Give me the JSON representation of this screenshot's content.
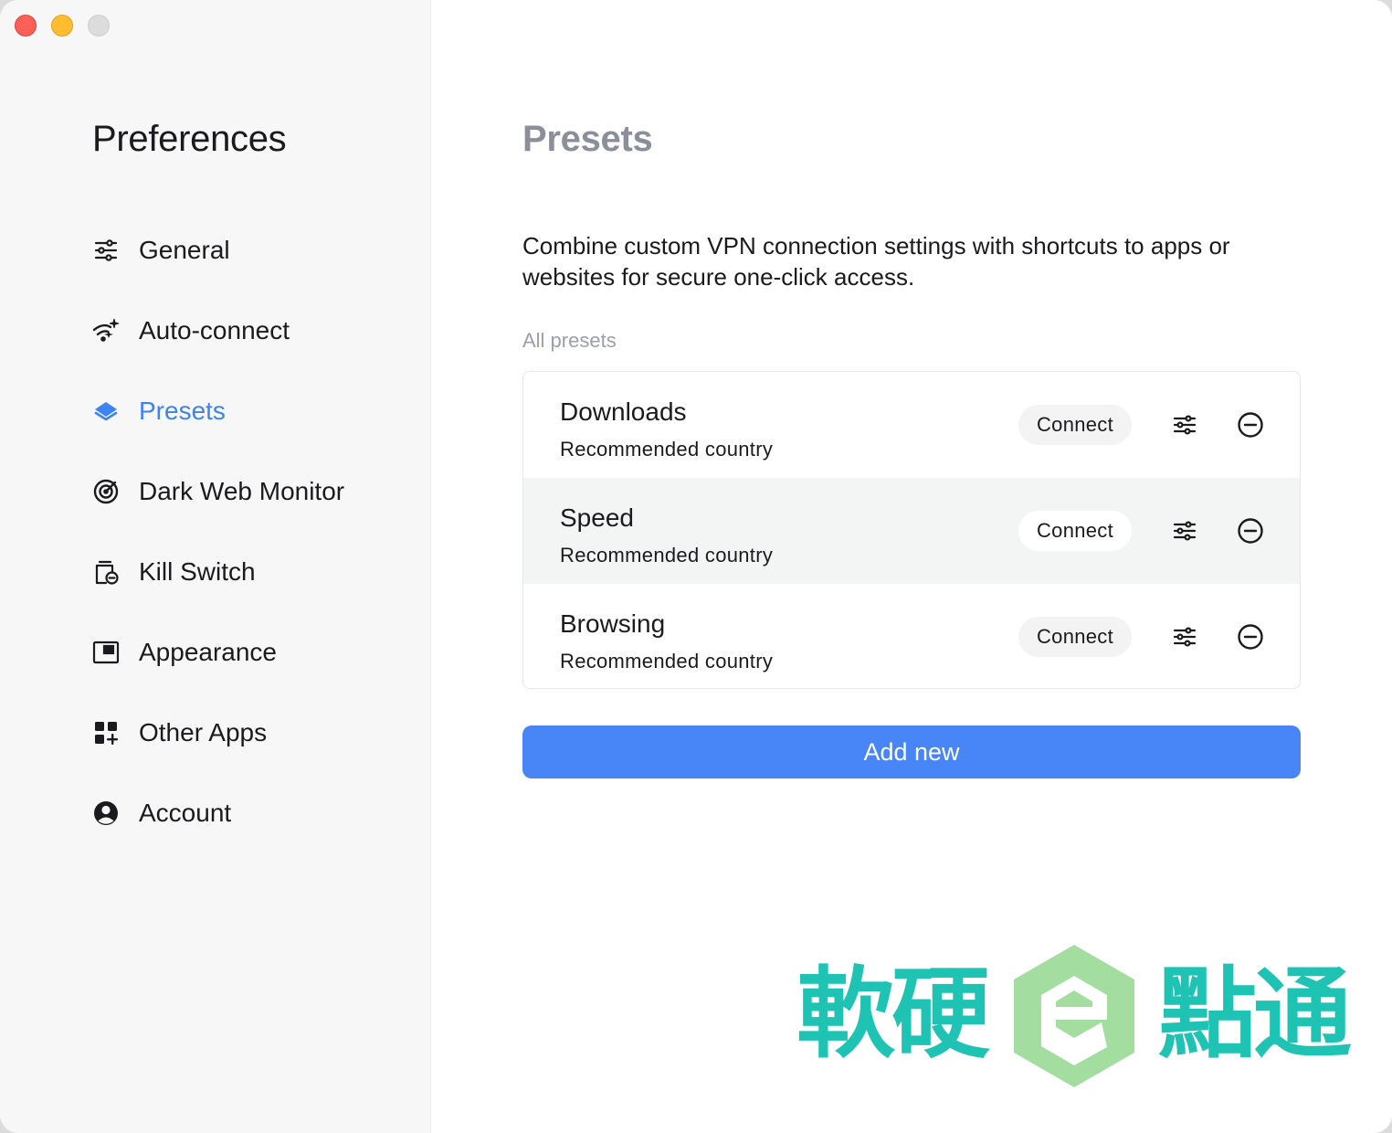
{
  "window": {
    "controls": [
      "close",
      "minimize",
      "zoom"
    ]
  },
  "sidebar": {
    "title": "Preferences",
    "items": [
      {
        "label": "General",
        "icon": "sliders-icon",
        "active": false
      },
      {
        "label": "Auto-connect",
        "icon": "wifi-sparkle-icon",
        "active": false
      },
      {
        "label": "Presets",
        "icon": "layers-icon",
        "active": true
      },
      {
        "label": "Dark Web Monitor",
        "icon": "target-icon",
        "active": false
      },
      {
        "label": "Kill Switch",
        "icon": "kill-switch-icon",
        "active": false
      },
      {
        "label": "Appearance",
        "icon": "appearance-window-icon",
        "active": false
      },
      {
        "label": "Other Apps",
        "icon": "apps-grid-icon",
        "active": false
      },
      {
        "label": "Account",
        "icon": "user-circle-icon",
        "active": false
      }
    ]
  },
  "main": {
    "title": "Presets",
    "description": "Combine custom VPN connection settings with shortcuts to apps or websites for secure one-click access.",
    "section_label": "All presets",
    "presets": [
      {
        "name": "Downloads",
        "subtitle": "Recommended country",
        "connect_label": "Connect"
      },
      {
        "name": "Speed",
        "subtitle": "Recommended country",
        "connect_label": "Connect"
      },
      {
        "name": "Browsing",
        "subtitle": "Recommended country",
        "connect_label": "Connect"
      }
    ],
    "add_button": "Add new"
  },
  "watermark": {
    "text_left": "軟硬",
    "text_right": "點通",
    "logo_letter": "e"
  },
  "colors": {
    "accent": "#3d83f2",
    "button": "#4886f7",
    "watermark_teal": "#1fc3b3",
    "watermark_green": "#a3dea0"
  }
}
